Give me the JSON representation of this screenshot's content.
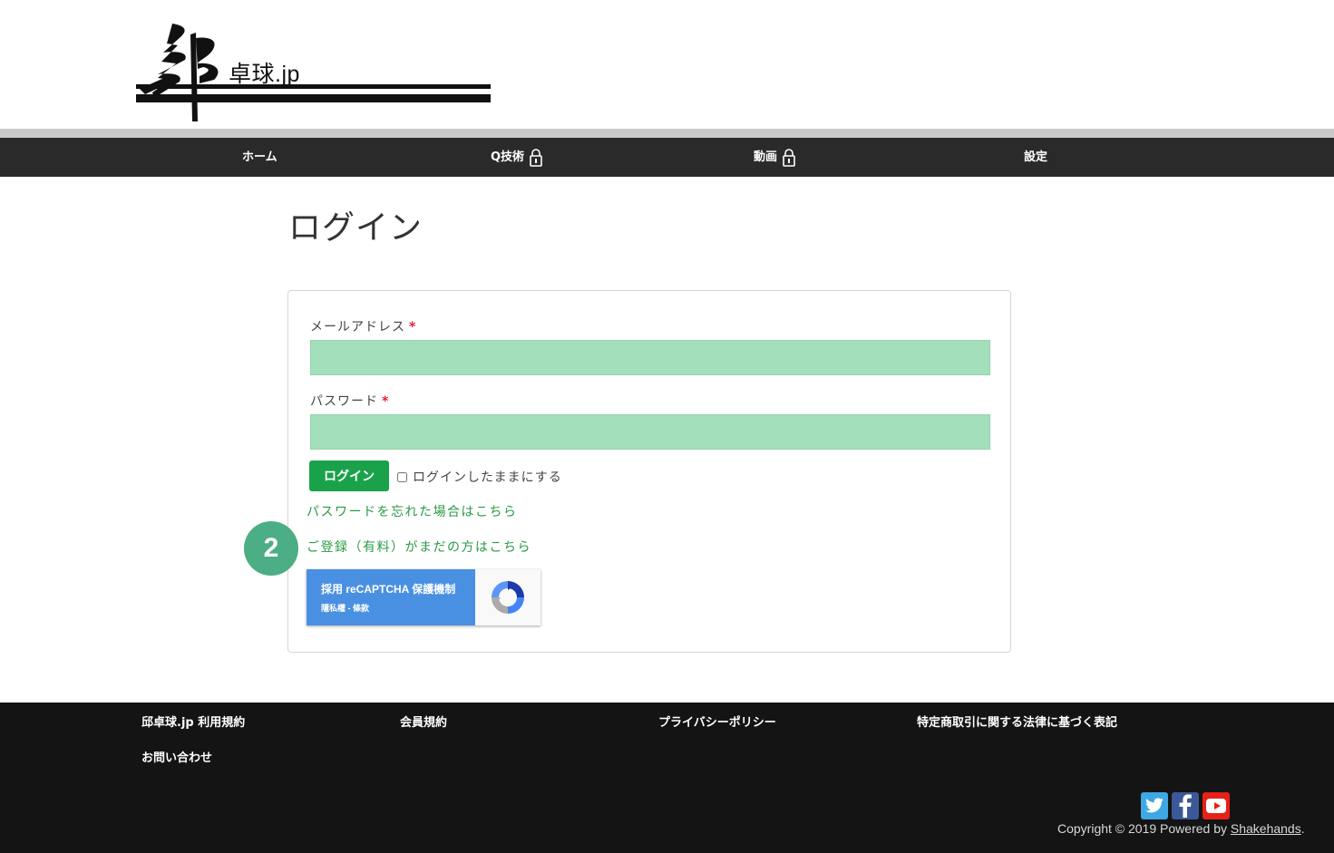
{
  "header": {
    "logo_text": "卓球.jp",
    "logo_glyph": "邱"
  },
  "nav": {
    "items": [
      {
        "label": "ホーム",
        "locked": false
      },
      {
        "label": "Q技術",
        "locked": true
      },
      {
        "label": "動画",
        "locked": true
      },
      {
        "label": "設定",
        "locked": false
      }
    ]
  },
  "main": {
    "title": "ログイン",
    "email_label": "メールアドレス",
    "email_value": "",
    "password_label": "パスワード",
    "password_value": "",
    "required_mark": "*",
    "login_button": "ログイン",
    "remember_label": "ログインしたままにする",
    "remember_checked": false,
    "forgot_link": "パスワードを忘れた場合はこちら",
    "register_link": "ご登録（有料）がまだの方はこちら",
    "step_badge": "2",
    "recaptcha": {
      "title": "採用 reCAPTCHA 保護機制",
      "sub": "隱私權 - 條款"
    }
  },
  "footer": {
    "links": [
      "邱卓球.jp 利用規約",
      "会員規約",
      "プライバシーポリシー",
      "特定商取引に関する法律に基づく表記",
      "お問い合わせ"
    ],
    "copyright_prefix": "Copyright © 2019 Powered by ",
    "copyright_link": "Shakehands",
    "copyright_suffix": ".",
    "social": [
      "twitter-icon",
      "facebook-icon",
      "youtube-icon"
    ]
  },
  "colors": {
    "nav_bg": "#2a2a2a",
    "input_bg": "#a3dfbb",
    "accent_green": "#19a24a",
    "link_green": "#2a9a45",
    "badge": "#4cae84",
    "recaptcha_blue": "#4a90e2",
    "footer_bg": "#141414"
  }
}
